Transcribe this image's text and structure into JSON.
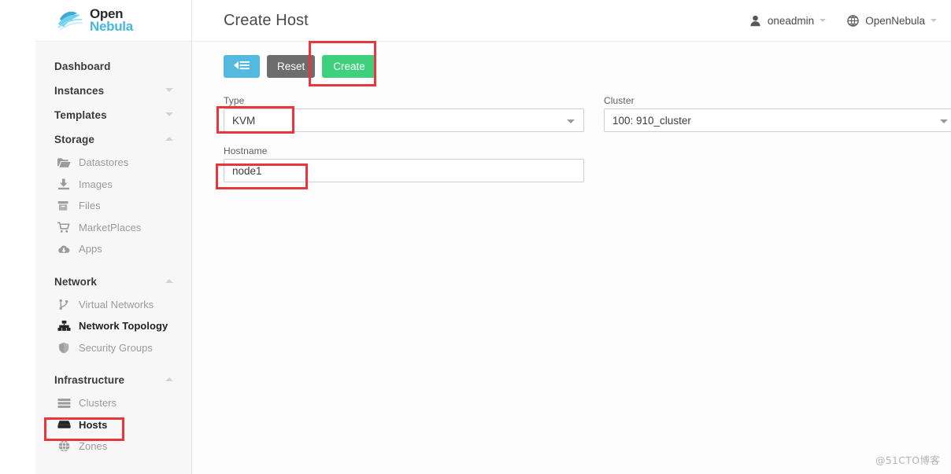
{
  "brand": {
    "logo_open": "Open",
    "logo_nebula": "Nebula",
    "accent_blue": "#46b8e0",
    "accent_green": "#3fd07d",
    "annotation_red": "#e8373c"
  },
  "sidebar": {
    "groups": [
      {
        "label": "Dashboard",
        "caret": "none",
        "items": []
      },
      {
        "label": "Instances",
        "caret": "down",
        "items": []
      },
      {
        "label": "Templates",
        "caret": "down",
        "items": []
      },
      {
        "label": "Storage",
        "caret": "up",
        "items": [
          {
            "label": "Datastores",
            "icon": "folder-icon",
            "active": false
          },
          {
            "label": "Images",
            "icon": "download-image-icon",
            "active": false
          },
          {
            "label": "Files",
            "icon": "archive-box-icon",
            "active": false
          },
          {
            "label": "MarketPlaces",
            "icon": "shopping-cart-icon",
            "active": false
          },
          {
            "label": "Apps",
            "icon": "cloud-download-icon",
            "active": false
          }
        ]
      },
      {
        "label": "Network",
        "caret": "up",
        "items": [
          {
            "label": "Virtual Networks",
            "icon": "network-branch-icon",
            "active": false
          },
          {
            "label": "Network Topology",
            "icon": "sitemap-icon",
            "active": true
          },
          {
            "label": "Security Groups",
            "icon": "shield-icon",
            "active": false
          }
        ]
      },
      {
        "label": "Infrastructure",
        "caret": "up",
        "items": [
          {
            "label": "Clusters",
            "icon": "server-stack-icon",
            "active": false
          },
          {
            "label": "Hosts",
            "icon": "host-server-icon",
            "active": false
          },
          {
            "label": "Zones",
            "icon": "globe-grid-icon",
            "active": false
          }
        ]
      }
    ]
  },
  "topbar": {
    "title": "Create Host",
    "user": {
      "label": "oneadmin",
      "icon": "user-icon"
    },
    "zone": {
      "label": "OpenNebula",
      "icon": "globe-icon"
    }
  },
  "actions": {
    "back_icon": "back-to-list-icon",
    "reset_label": "Reset",
    "create_label": "Create"
  },
  "form": {
    "type": {
      "label": "Type",
      "value": "KVM"
    },
    "cluster": {
      "label": "Cluster",
      "value": "100: 910_cluster"
    },
    "hostname": {
      "label": "Hostname",
      "value": "node1"
    }
  },
  "watermark": "@51CTO博客"
}
